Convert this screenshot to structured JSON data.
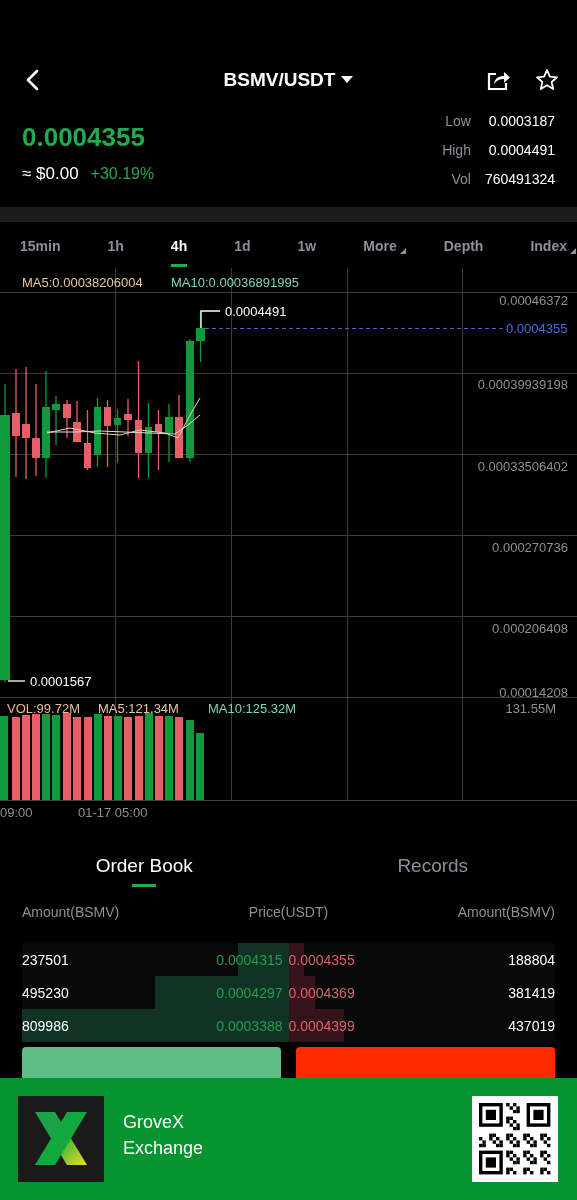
{
  "header": {
    "title": "BSMV/USDT"
  },
  "ticker": {
    "price": "0.0004355",
    "fiat": "≈ $0.00",
    "change": "+30.19%",
    "stats": [
      {
        "label": "Low",
        "value": "0.0003187"
      },
      {
        "label": "High",
        "value": "0.0004491"
      },
      {
        "label": "Vol",
        "value": "760491324"
      }
    ]
  },
  "intervals": [
    {
      "label": "15min",
      "selected": false,
      "dropdown": false
    },
    {
      "label": "1h",
      "selected": false,
      "dropdown": false
    },
    {
      "label": "4h",
      "selected": true,
      "dropdown": false
    },
    {
      "label": "1d",
      "selected": false,
      "dropdown": false
    },
    {
      "label": "1w",
      "selected": false,
      "dropdown": false
    },
    {
      "label": "More",
      "selected": false,
      "dropdown": true
    },
    {
      "label": "Depth",
      "selected": false,
      "dropdown": false
    },
    {
      "label": "Index",
      "selected": false,
      "dropdown": true
    }
  ],
  "chart": {
    "ma_labels": [
      {
        "text": "MA5:0.00038206004",
        "color": "#e9c79b"
      },
      {
        "text": "MA10:0.00036891995",
        "color": "#7fd3bf"
      }
    ],
    "price_labels": [
      "0.00046372",
      "0.00039939198",
      "0.00033506402",
      "0.000270736",
      "0.000206408",
      "0.00014208"
    ],
    "high_label": "0.0004491",
    "low_label": "0.0001567",
    "last_price_label": "0.0004355",
    "volume_labels": [
      {
        "text": "VOL:99.72M",
        "color": "#e9b98f"
      },
      {
        "text": "MA5:121.34M",
        "color": "#e9c79b"
      },
      {
        "text": "MA10:125.32M",
        "color": "#7fd3bf"
      }
    ],
    "volume_axis_label": "131.55M",
    "time_labels": [
      "09:00",
      "01-17 05:00"
    ]
  },
  "order_tabs": [
    {
      "label": "Order Book",
      "selected": true
    },
    {
      "label": "Records",
      "selected": false
    }
  ],
  "order_book": {
    "columns": [
      "Amount(BSMV)",
      "Price(USDT)",
      "Amount(BSMV)"
    ],
    "rows": [
      {
        "bid": {
          "amount": "237501",
          "price": "0.0004315",
          "level": 0.19
        },
        "ask": {
          "price": "0.0004355",
          "amount": "188804",
          "level": 0.06
        }
      },
      {
        "bid": {
          "amount": "495230",
          "price": "0.0004297",
          "level": 0.5
        },
        "ask": {
          "price": "0.0004369",
          "amount": "381419",
          "level": 0.1
        }
      },
      {
        "bid": {
          "amount": "809986",
          "price": "0.0003388",
          "level": 1
        },
        "ask": {
          "price": "0.0004399",
          "amount": "437019",
          "level": 0.21
        }
      }
    ]
  },
  "buttons": [
    {
      "kind": "buy"
    },
    {
      "kind": "sell"
    }
  ],
  "banner": {
    "name": "GroveX",
    "subtitle": "Exchange"
  }
}
